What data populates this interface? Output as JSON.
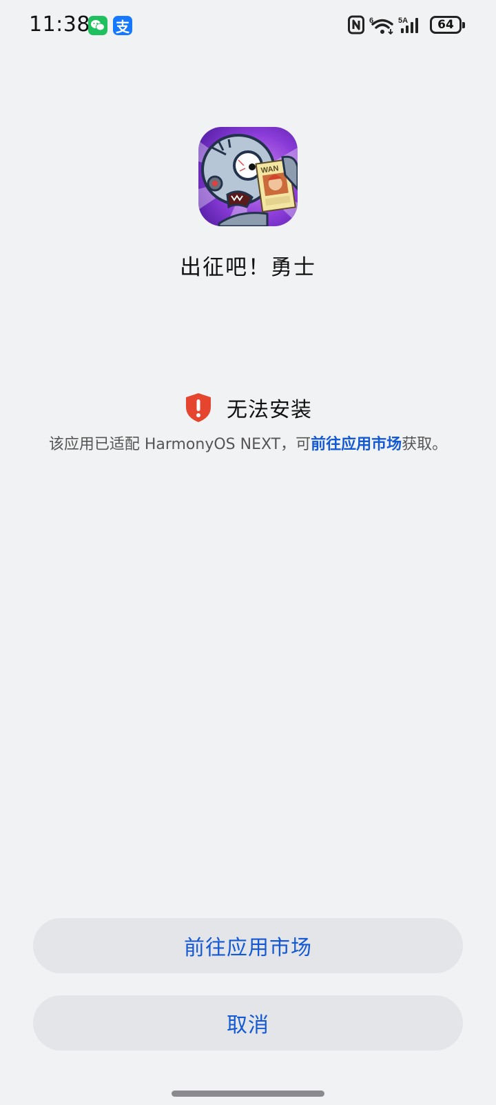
{
  "status_bar": {
    "time": "11:38",
    "notifications": [
      "wechat-icon",
      "alipay-icon"
    ],
    "alipay_glyph": "支",
    "wifi_badge": "6",
    "signal_badge": "5A",
    "battery_level": "64"
  },
  "app": {
    "name": "出征吧！勇士",
    "icon": "app-icon"
  },
  "install": {
    "title": "无法安装",
    "desc_prefix": "该应用已适配 HarmonyOS NEXT，可",
    "desc_link": "前往应用市场",
    "desc_suffix": "获取。",
    "icon": "shield-alert-icon",
    "icon_color": "#e5452f",
    "link_color": "#1358d4"
  },
  "buttons": {
    "market_label": "前往应用市场",
    "cancel_label": "取消"
  }
}
